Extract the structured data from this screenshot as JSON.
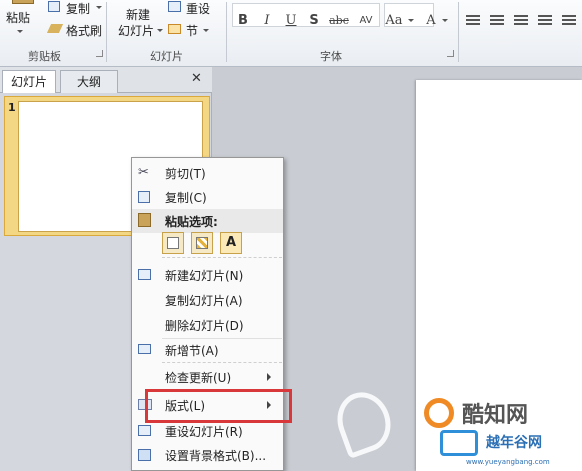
{
  "ribbon": {
    "clipboard": {
      "paste": "粘贴",
      "copy": "复制",
      "format_painter": "格式刷",
      "label": "剪贴板"
    },
    "slides": {
      "new_slide_line1": "新建",
      "new_slide_line2": "幻灯片",
      "reset": "重设",
      "section": "节",
      "label": "幻灯片"
    },
    "font": {
      "bold": "B",
      "italic": "I",
      "underline": "U",
      "shadow": "S",
      "strike": "abc",
      "spacing": "AV",
      "case": "Aa",
      "color": "A",
      "label": "字体"
    }
  },
  "panel": {
    "tab_slides": "幻灯片",
    "tab_outline": "大纲",
    "close": "✕",
    "slide_number": "1"
  },
  "context_menu": {
    "cut": "剪切(T)",
    "copy": "复制(C)",
    "paste_options": "粘贴选项:",
    "paste_text_only": "A",
    "new_slide": "新建幻灯片(N)",
    "duplicate_slide": "复制幻灯片(A)",
    "delete_slide": "删除幻灯片(D)",
    "add_section": "新增节(A)",
    "check_updates": "检查更新(U)",
    "layout": "版式(L)",
    "reset_slide": "重设幻灯片(R)",
    "format_background": "设置背景格式(B)..."
  },
  "watermark": {
    "brand": "酷知网",
    "site_name": "越年谷网",
    "url": "www.yueyangbang.com"
  },
  "colors": {
    "highlight": "#d9383a",
    "selection": "#f4d784"
  }
}
